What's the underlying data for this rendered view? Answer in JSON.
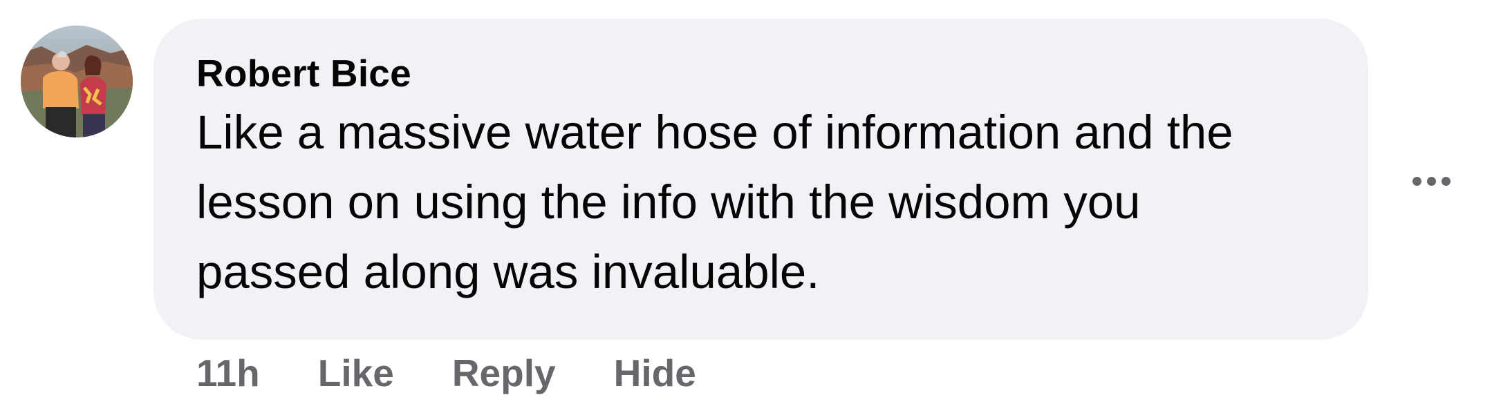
{
  "comment": {
    "author": "Robert Bice",
    "text": "Like a massive water hose of information and the lesson on using the info with the wisdom you passed along was invaluable.",
    "timestamp": "11h",
    "actions": {
      "like_label": "Like",
      "reply_label": "Reply",
      "hide_label": "Hide"
    }
  },
  "icons": {
    "more_options": "more-horizontal-icon",
    "avatar": "profile-photo"
  },
  "colors": {
    "bubble_bg": "#f0f2f5",
    "text": "#050505",
    "secondary_text": "#65676b"
  }
}
